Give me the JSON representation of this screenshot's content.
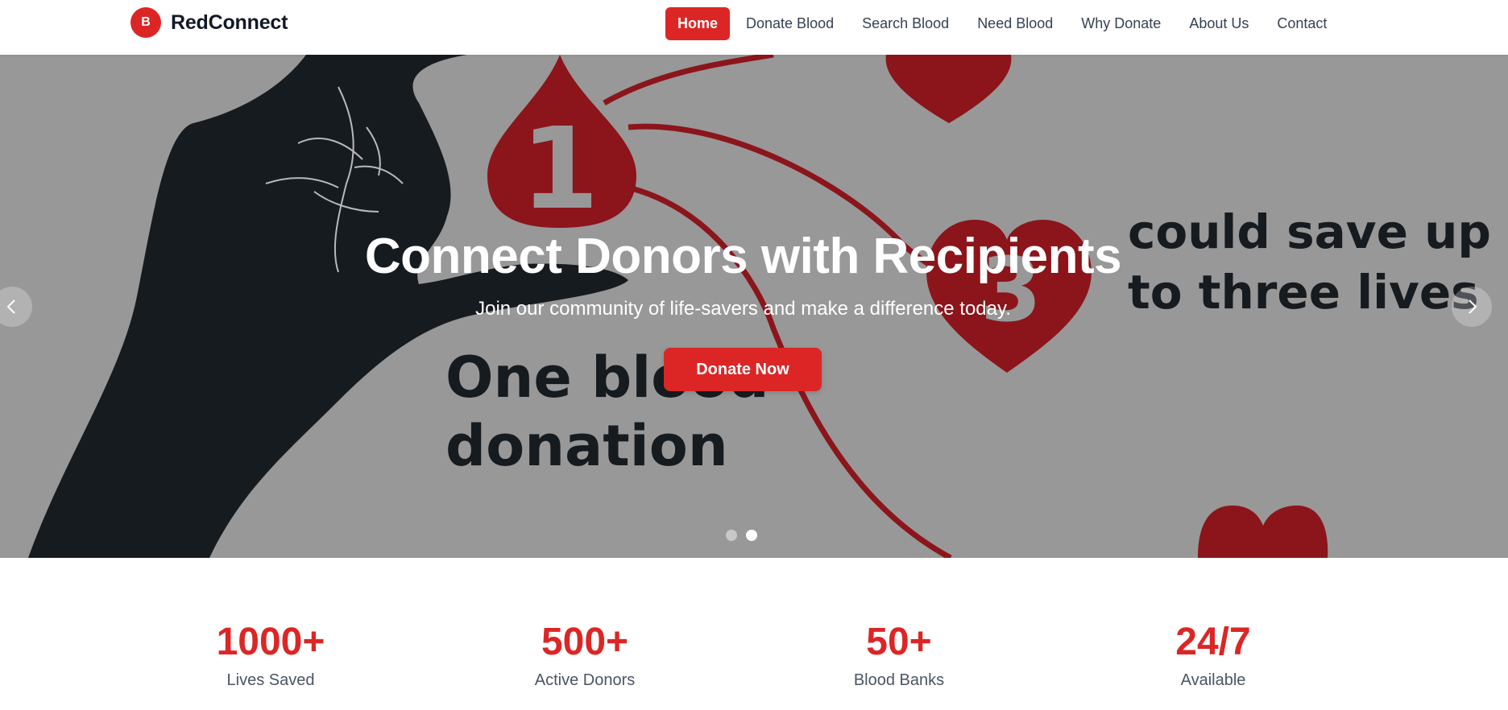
{
  "brand": {
    "badge": "B",
    "name": "RedConnect"
  },
  "nav": {
    "items": [
      {
        "label": "Home",
        "active": true
      },
      {
        "label": "Donate Blood"
      },
      {
        "label": "Search Blood"
      },
      {
        "label": "Need Blood"
      },
      {
        "label": "Why Donate"
      },
      {
        "label": "About Us"
      },
      {
        "label": "Contact"
      }
    ]
  },
  "hero": {
    "title": "Connect Donors with Recipients",
    "subtitle": "Join our community of life-savers and make a difference today.",
    "cta_label": "Donate Now",
    "image_text": {
      "number_one": "1",
      "number_three": "3",
      "left_line1": "One blood",
      "left_line2": "donation",
      "right_line1": "could save up",
      "right_line2": "to three lives"
    },
    "slides_total": 2,
    "active_slide": 2
  },
  "stats": [
    {
      "value": "1000+",
      "label": "Lives Saved"
    },
    {
      "value": "500+",
      "label": "Active Donors"
    },
    {
      "value": "50+",
      "label": "Blood Banks"
    },
    {
      "value": "24/7",
      "label": "Available"
    }
  ],
  "colors": {
    "accent": "#dc2626",
    "hero_bg": "#989898",
    "blood": "#8b151b",
    "ink": "#161b20"
  },
  "icons": {
    "prev": "chevron-left-icon",
    "next": "chevron-right-icon"
  }
}
